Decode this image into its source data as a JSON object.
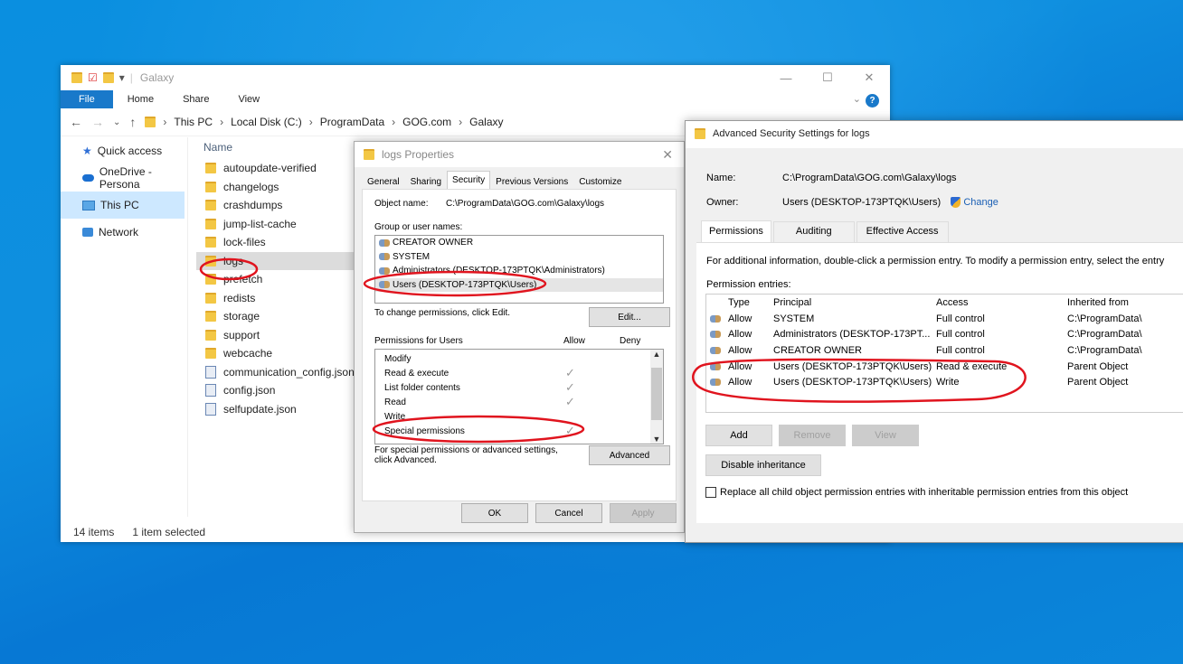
{
  "explorer": {
    "title": "Galaxy",
    "controls": {
      "minimize": "—",
      "maximize": "☐",
      "close": "✕"
    },
    "ribbon_tabs": [
      "File",
      "Home",
      "Share",
      "View"
    ],
    "help": "?",
    "breadcrumb": [
      "This PC",
      "Local Disk (C:)",
      "ProgramData",
      "GOG.com",
      "Galaxy"
    ],
    "sidebar": [
      "Quick access",
      "OneDrive - Persona",
      "This PC",
      "Network"
    ],
    "column_name": "Name",
    "files": [
      "autoupdate-verified",
      "changelogs",
      "crashdumps",
      "jump-list-cache",
      "lock-files",
      "logs",
      "prefetch",
      "redists",
      "storage",
      "support",
      "webcache",
      "communication_config.json",
      "config.json",
      "selfupdate.json"
    ],
    "status_items": "14 items",
    "status_selected": "1 item selected"
  },
  "props": {
    "title": "logs Properties",
    "close": "✕",
    "tabs": [
      "General",
      "Sharing",
      "Security",
      "Previous Versions",
      "Customize"
    ],
    "object_label": "Object name:",
    "object_value": "C:\\ProgramData\\GOG.com\\Galaxy\\logs",
    "group_label": "Group or user names:",
    "users": [
      "CREATOR OWNER",
      "SYSTEM",
      "Administrators (DESKTOP-173PTQK\\Administrators)",
      "Users (DESKTOP-173PTQK\\Users)"
    ],
    "change_text": "To change permissions, click Edit.",
    "edit_button": "Edit...",
    "perm_for": "Permissions for Users",
    "allow": "Allow",
    "deny": "Deny",
    "permissions": [
      "Modify",
      "Read & execute",
      "List folder contents",
      "Read",
      "Write",
      "Special permissions"
    ],
    "allowed": [
      false,
      true,
      true,
      true,
      false,
      true
    ],
    "special_text": "For special permissions or advanced settings, click Advanced.",
    "advanced_button": "Advanced",
    "ok": "OK",
    "cancel": "Cancel",
    "apply": "Apply"
  },
  "adv": {
    "title": "Advanced Security Settings for logs",
    "name_label": "Name:",
    "name_value": "C:\\ProgramData\\GOG.com\\Galaxy\\logs",
    "owner_label": "Owner:",
    "owner_value": "Users (DESKTOP-173PTQK\\Users)",
    "change_link": "Change",
    "tabs": [
      "Permissions",
      "Auditing",
      "Effective Access"
    ],
    "info": "For additional information, double-click a permission entry. To modify a permission entry, select the entry",
    "entries_label": "Permission entries:",
    "headers": [
      "Type",
      "Principal",
      "Access",
      "Inherited from"
    ],
    "rows": [
      [
        "Allow",
        "SYSTEM",
        "Full control",
        "C:\\ProgramData\\"
      ],
      [
        "Allow",
        "Administrators (DESKTOP-173PT...",
        "Full control",
        "C:\\ProgramData\\"
      ],
      [
        "Allow",
        "CREATOR OWNER",
        "Full control",
        "C:\\ProgramData\\"
      ],
      [
        "Allow",
        "Users (DESKTOP-173PTQK\\Users)",
        "Read & execute",
        "Parent Object"
      ],
      [
        "Allow",
        "Users (DESKTOP-173PTQK\\Users)",
        "Write",
        "Parent Object"
      ]
    ],
    "add": "Add",
    "remove": "Remove",
    "view": "View",
    "disable_inheritance": "Disable inheritance",
    "replace_text": "Replace all child object permission entries with inheritable permission entries from this object"
  },
  "colors": {
    "accent": "#1979ca",
    "annotation": "#e0141e"
  }
}
